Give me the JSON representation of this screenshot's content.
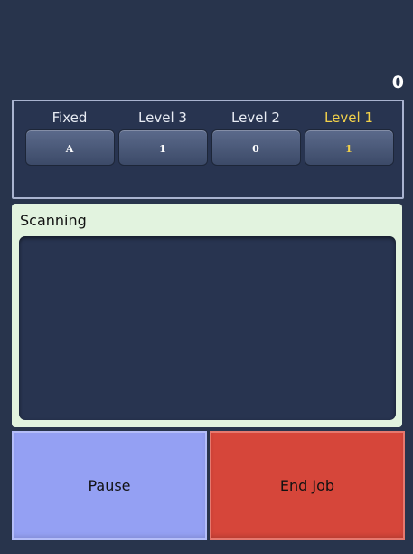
{
  "counter": "0",
  "levels": [
    {
      "label": "Fixed",
      "value": "A",
      "active": false
    },
    {
      "label": "Level 3",
      "value": "1",
      "active": false
    },
    {
      "label": "Level 2",
      "value": "0",
      "active": false
    },
    {
      "label": "Level 1",
      "value": "1",
      "active": true
    }
  ],
  "colors": {
    "background": "#28344c",
    "active_level": "#f2d14a",
    "scan_panel": "#e2f3df",
    "pause": "#94a0f3",
    "end_job": "#d6463a"
  },
  "scan": {
    "label": "Scanning"
  },
  "buttons": {
    "pause_label": "Pause",
    "end_job_label": "End Job"
  }
}
